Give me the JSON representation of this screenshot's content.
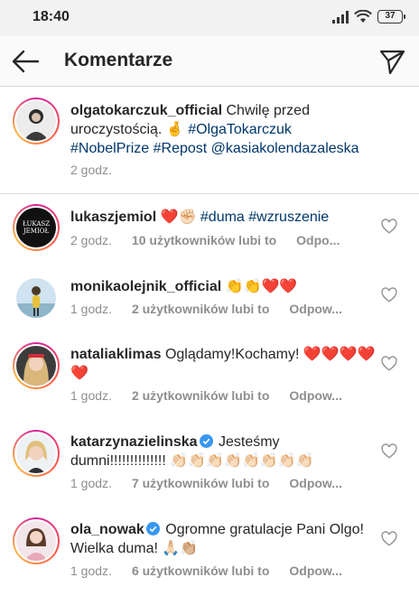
{
  "status_bar": {
    "time": "18:40",
    "battery": "37"
  },
  "header": {
    "title": "Komentarze"
  },
  "caption": {
    "username": "olgatokarczuk_official",
    "text": " Chwilę przed uroczystością. 🤞 ",
    "tags": [
      "#OlgaTokarczuk",
      "#NobelPrize",
      "#Repost",
      "@kasiakolendazaleska"
    ],
    "time": "2 godz."
  },
  "comments": [
    {
      "username": "lukaszjemiol",
      "text": " ❤️✊🏻 ",
      "tags": [
        "#duma",
        "#wzruszenie"
      ],
      "time": "2 godz.",
      "likes": "10 użytkowników lubi to",
      "reply": "Odpo...",
      "avatar_text": "ŁUKASZ JEMIOŁ"
    },
    {
      "username": "monikaolejnik_official",
      "text": " 👏👏❤️❤️",
      "time": "1 godz.",
      "likes": "2 użytkowników lubi to",
      "reply": "Odpow..."
    },
    {
      "username": "nataliaklimas",
      "text": " Oglądamy!Kochamy! ❤️❤️❤️❤️❤️",
      "time": "1 godz.",
      "likes": "2 użytkowników lubi to",
      "reply": "Odpow..."
    },
    {
      "username": "katarzynazielinska",
      "text": " Jesteśmy dumni!!!!!!!!!!!!!! 👏🏻👏🏻👏🏻👏🏻👏🏻👏🏻👏🏻👏🏻",
      "time": "1 godz.",
      "likes": "7 użytkowników lubi to",
      "reply": "Odpow...",
      "verified": true
    },
    {
      "username": "ola_nowak",
      "text": " Ogromne gratulacje Pani Olgo! Wielka duma! 🙏🏻👏🏼",
      "time": "1 godz.",
      "likes": "6 użytkowników lubi to",
      "reply": "Odpow...",
      "verified": true
    }
  ],
  "colors": {
    "link": "#00376b",
    "muted": "#8e8e8e",
    "verified": "#3897f0",
    "divider": "#dbdbdb"
  }
}
